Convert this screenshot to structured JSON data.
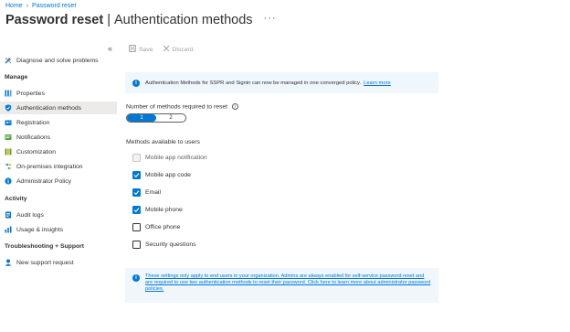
{
  "breadcrumb": {
    "home": "Home",
    "current": "Password reset"
  },
  "header": {
    "title": "Password reset",
    "subtitle": "Authentication methods",
    "more": "···"
  },
  "sidebar": {
    "collapse_icon": "«",
    "diagnose": "Diagnose and solve problems",
    "sections": {
      "manage": "Manage",
      "activity": "Activity",
      "troubleshooting": "Troubleshooting + Support"
    },
    "manage_items": [
      {
        "label": "Properties",
        "icon": "properties-icon"
      },
      {
        "label": "Authentication methods",
        "icon": "shield-icon",
        "active": true
      },
      {
        "label": "Registration",
        "icon": "registration-icon"
      },
      {
        "label": "Notifications",
        "icon": "notifications-icon"
      },
      {
        "label": "Customization",
        "icon": "customization-icon"
      },
      {
        "label": "On-premises integration",
        "icon": "integration-icon"
      },
      {
        "label": "Administrator Policy",
        "icon": "info-icon"
      }
    ],
    "activity_items": [
      {
        "label": "Audit logs",
        "icon": "audit-logs-icon"
      },
      {
        "label": "Usage & insights",
        "icon": "usage-insights-icon"
      }
    ],
    "support_items": [
      {
        "label": "New support request",
        "icon": "support-request-icon"
      }
    ]
  },
  "toolbar": {
    "save": "Save",
    "discard": "Discard"
  },
  "banner": {
    "text": "Authentication Methods for SSPR and Signin can now be managed in one converged policy.",
    "link": "Learn more"
  },
  "methods_required": {
    "label": "Number of methods required to reset",
    "options": [
      "1",
      "2"
    ],
    "selected": "1"
  },
  "methods_available": {
    "label": "Methods available to users",
    "items": [
      {
        "label": "Mobile app notification",
        "checked": false,
        "disabled": true
      },
      {
        "label": "Mobile app code",
        "checked": true,
        "disabled": false
      },
      {
        "label": "Email",
        "checked": true,
        "disabled": false
      },
      {
        "label": "Mobile phone",
        "checked": true,
        "disabled": false
      },
      {
        "label": "Office phone",
        "checked": false,
        "disabled": false
      },
      {
        "label": "Security questions",
        "checked": false,
        "disabled": false
      }
    ]
  },
  "footer_note": {
    "text": "These settings only apply to end users in your organization. Admins are always enabled for self-service password reset and are required to use two authentication methods to reset their password. Click here to learn more about administrator password policies."
  },
  "colors": {
    "accent": "#0078d4",
    "info_bg": "#eff6fc",
    "active_nav": "#edebe9"
  }
}
